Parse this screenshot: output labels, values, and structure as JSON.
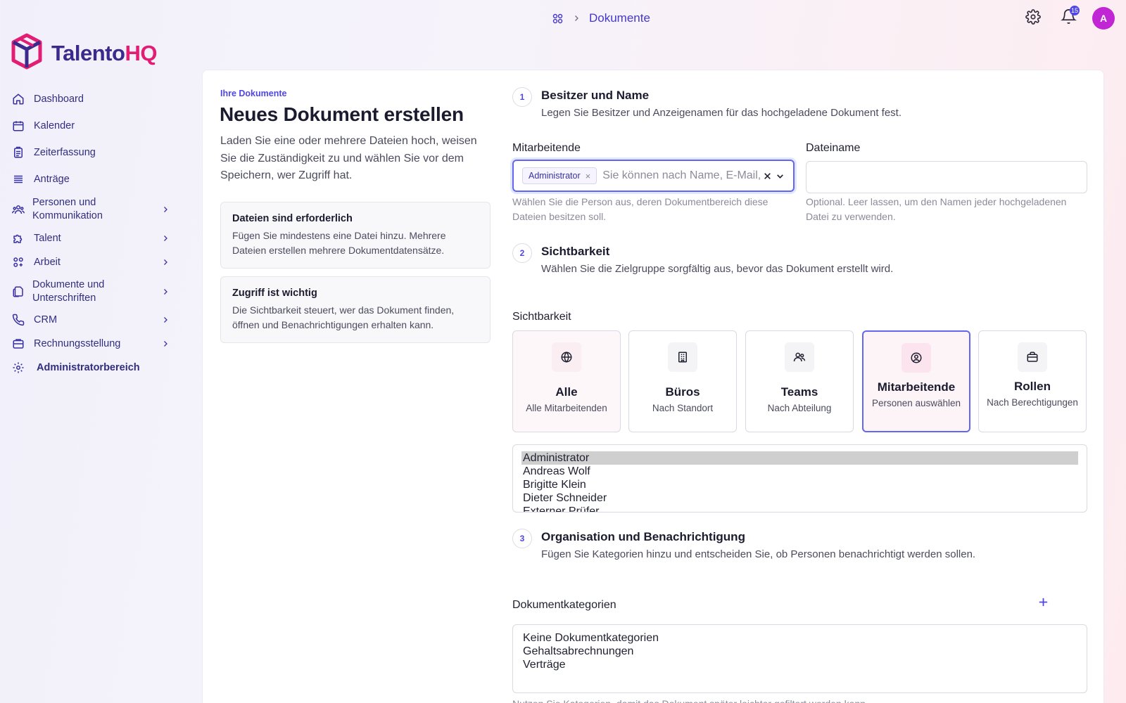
{
  "breadcrumb": {
    "current": "Dokumente"
  },
  "topbar": {
    "notification_count": "15",
    "avatar_initial": "A"
  },
  "brand": {
    "name_part1": "Talento",
    "name_part2": "HQ"
  },
  "sidebar": {
    "items": [
      {
        "label": "Dashboard",
        "icon": "home-icon"
      },
      {
        "label": "Kalender",
        "icon": "calendar-icon"
      },
      {
        "label": "Zeiterfassung",
        "icon": "timesheet-icon"
      },
      {
        "label": "Anträge",
        "icon": "list-icon"
      },
      {
        "label": "Personen und Kommunikation",
        "icon": "users-icon"
      },
      {
        "label": "Talent",
        "icon": "puzzle-icon"
      },
      {
        "label": "Arbeit",
        "icon": "grid-icon"
      },
      {
        "label": "Dokumente und Unterschriften",
        "icon": "documents-icon"
      },
      {
        "label": "CRM",
        "icon": "phone-icon"
      },
      {
        "label": "Rechnungsstellung",
        "icon": "invoice-icon"
      },
      {
        "label": "Administratorbereich",
        "icon": "gear-icon"
      }
    ]
  },
  "page": {
    "eyebrow": "Ihre Dokumente",
    "title": "Neues Dokument erstellen",
    "intro": "Laden Sie eine oder mehrere Dateien hoch, weisen Sie die Zuständigkeit zu und wählen Sie vor dem Speichern, wer Zugriff hat.",
    "info_boxes": [
      {
        "title": "Dateien sind erforderlich",
        "text": "Fügen Sie mindestens eine Datei hinzu. Mehrere Dateien erstellen mehrere Dokumentdatensätze."
      },
      {
        "title": "Zugriff ist wichtig",
        "text": "Die Sichtbarkeit steuert, wer das Dokument finden, öffnen und Benachrichtigungen erhalten kann."
      }
    ]
  },
  "steps": [
    {
      "number": "1",
      "title": "Besitzer und Name",
      "description": "Legen Sie Besitzer und Anzeigenamen für das hochgeladene Dokument fest."
    },
    {
      "number": "2",
      "title": "Sichtbarkeit",
      "description": "Wählen Sie die Zielgruppe sorgfältig aus, bevor das Dokument erstellt wird."
    },
    {
      "number": "3",
      "title": "Organisation und Benachrichtigung",
      "description": "Fügen Sie Kategorien hinzu und entscheiden Sie, ob Personen benachrichtigt werden sollen."
    }
  ],
  "owner": {
    "label": "Mitarbeitende",
    "chip": "Administrator",
    "placeholder": "Sie können nach Name, E-Mail, Büro suchen",
    "help": "Wählen Sie die Person aus, deren Dokumentbereich diese Dateien besitzen soll."
  },
  "filename": {
    "label": "Dateiname",
    "value": "",
    "help": "Optional. Leer lassen, um den Namen jeder hochgeladenen Datei zu verwenden."
  },
  "visibility": {
    "label": "Sichtbarkeit",
    "options": [
      {
        "title": "Alle",
        "subtitle": "Alle Mitarbeitenden",
        "icon": "globe-icon"
      },
      {
        "title": "Büros",
        "subtitle": "Nach Standort",
        "icon": "building-icon"
      },
      {
        "title": "Teams",
        "subtitle": "Nach Abteilung",
        "icon": "team-icon"
      },
      {
        "title": "Mitarbeitende",
        "subtitle": "Personen auswählen",
        "icon": "user-circle-icon"
      },
      {
        "title": "Rollen",
        "subtitle": "Nach Berechtigungen",
        "icon": "briefcase-icon"
      }
    ],
    "selected": "Mitarbeitende",
    "people": [
      "Administrator",
      "Andreas Wolf",
      "Brigitte Klein",
      "Dieter Schneider",
      "Externer Prüfer"
    ],
    "people_selected": "Administrator"
  },
  "categories": {
    "label": "Dokumentkategorien",
    "options": [
      "Keine Dokumentkategorien",
      "Gehaltsabrechnungen",
      "Verträge"
    ],
    "help": "Nutzen Sie Kategorien, damit das Dokument später leichter gefiltert werden kann."
  },
  "colors": {
    "accent": "#4f46e5",
    "brand_pink": "#e11d74",
    "brand_navy": "#3b2a8c"
  }
}
